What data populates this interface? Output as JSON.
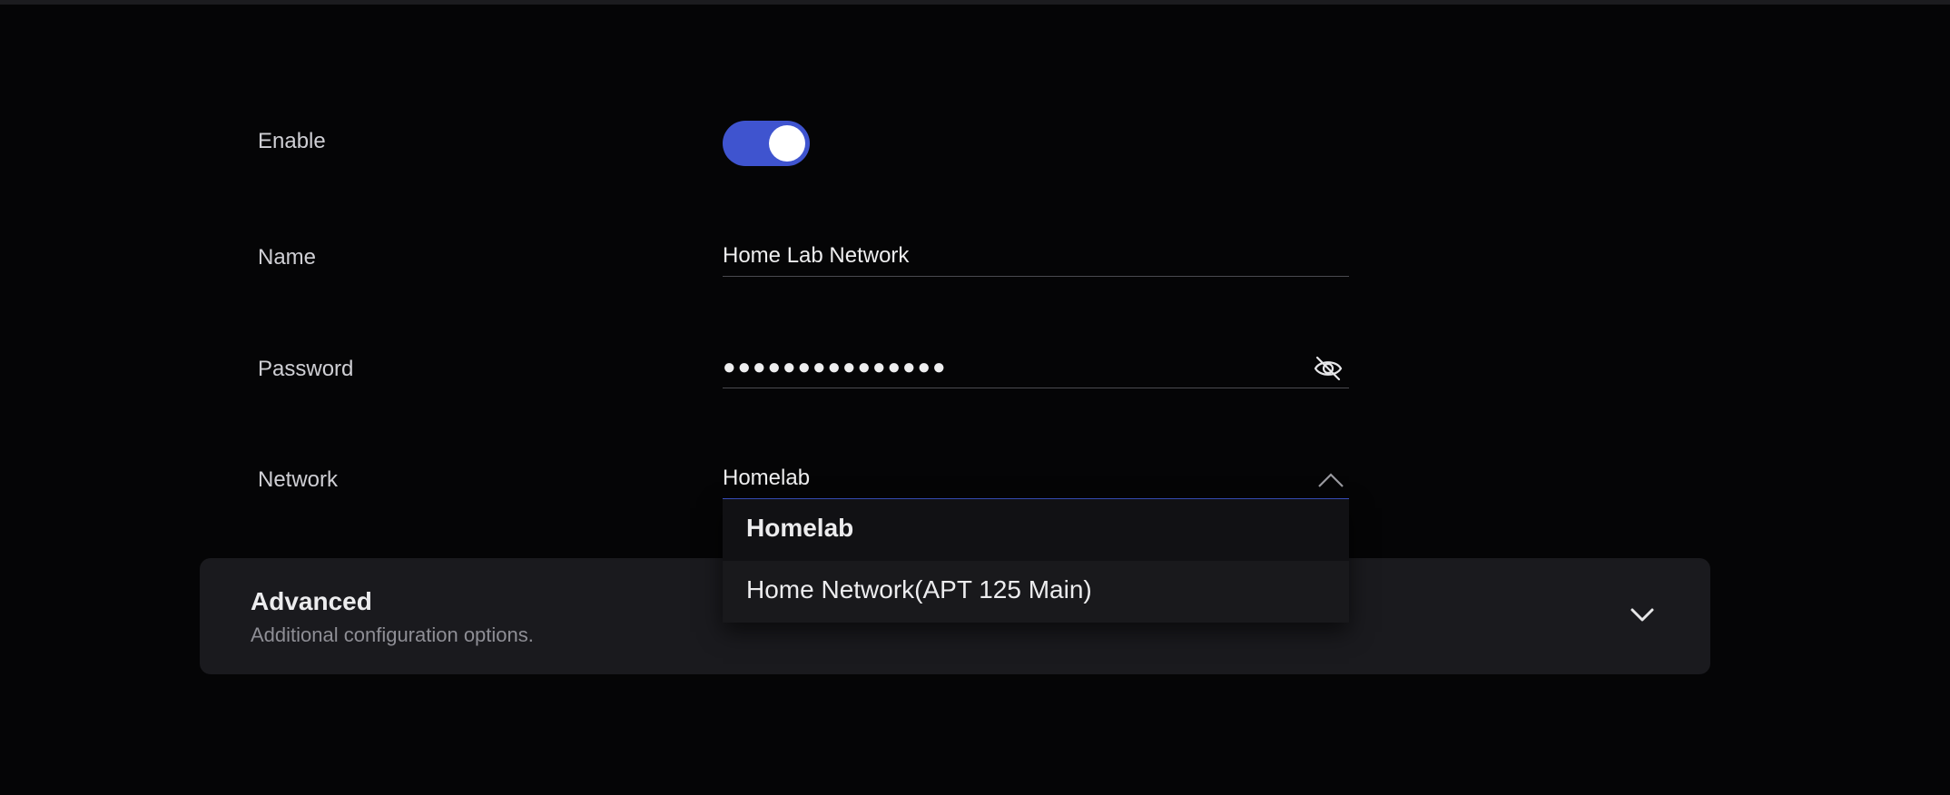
{
  "form": {
    "enable": {
      "label": "Enable",
      "value": true
    },
    "name": {
      "label": "Name",
      "value": "Home Lab Network"
    },
    "password": {
      "label": "Password",
      "masked_value": "●●●●●●●●●●●●●●●"
    },
    "network": {
      "label": "Network",
      "value": "Homelab"
    }
  },
  "dropdown": {
    "options": [
      {
        "label": "Homelab"
      },
      {
        "label": "Home Network(APT 125 Main)"
      }
    ]
  },
  "advanced": {
    "title": "Advanced",
    "subtitle": "Additional configuration options."
  },
  "colors": {
    "accent": "#3f54cf",
    "background": "#050506",
    "panel": "#1a1a1e"
  },
  "icons": {
    "password_toggle": "eye-off-icon",
    "network_select": "chevron-up-icon",
    "advanced_expand": "chevron-down-icon"
  }
}
